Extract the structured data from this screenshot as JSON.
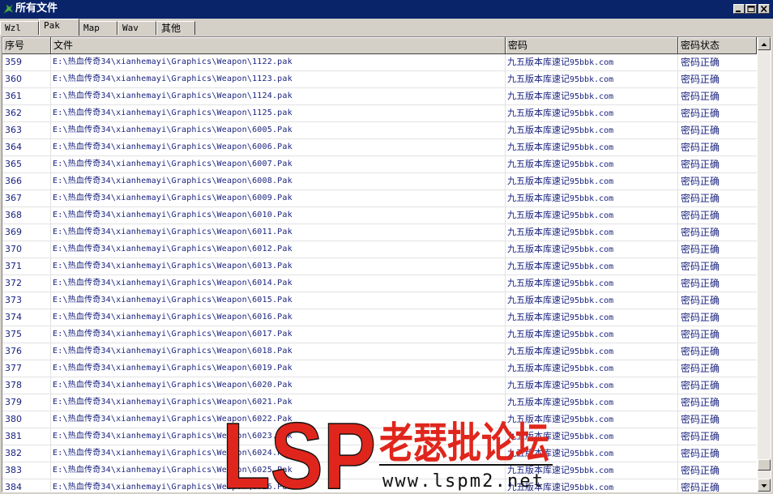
{
  "window": {
    "title": "所有文件"
  },
  "tabs": [
    {
      "label": "Wzl"
    },
    {
      "label": "Pak",
      "active": true
    },
    {
      "label": "Map"
    },
    {
      "label": "Wav"
    },
    {
      "label": "其他"
    }
  ],
  "table": {
    "columns": [
      "序号",
      "文件",
      "密码",
      "密码状态"
    ],
    "rows": [
      {
        "no": "359",
        "file": "E:\\热血传奇34\\xianhemayi\\Graphics\\Weapon\\1122.pak",
        "pwd_cn": "九五版本库速记",
        "pwd_en": "95bbk.com",
        "status": "密码正确"
      },
      {
        "no": "360",
        "file": "E:\\热血传奇34\\xianhemayi\\Graphics\\Weapon\\1123.pak",
        "pwd_cn": "九五版本库速记",
        "pwd_en": "95bbk.com",
        "status": "密码正确"
      },
      {
        "no": "361",
        "file": "E:\\热血传奇34\\xianhemayi\\Graphics\\Weapon\\1124.pak",
        "pwd_cn": "九五版本库速记",
        "pwd_en": "95bbk.com",
        "status": "密码正确"
      },
      {
        "no": "362",
        "file": "E:\\热血传奇34\\xianhemayi\\Graphics\\Weapon\\1125.pak",
        "pwd_cn": "九五版本库速记",
        "pwd_en": "95bbk.com",
        "status": "密码正确"
      },
      {
        "no": "363",
        "file": "E:\\热血传奇34\\xianhemayi\\Graphics\\Weapon\\6005.Pak",
        "pwd_cn": "九五版本库速记",
        "pwd_en": "95bbk.com",
        "status": "密码正确"
      },
      {
        "no": "364",
        "file": "E:\\热血传奇34\\xianhemayi\\Graphics\\Weapon\\6006.Pak",
        "pwd_cn": "九五版本库速记",
        "pwd_en": "95bbk.com",
        "status": "密码正确"
      },
      {
        "no": "365",
        "file": "E:\\热血传奇34\\xianhemayi\\Graphics\\Weapon\\6007.Pak",
        "pwd_cn": "九五版本库速记",
        "pwd_en": "95bbk.com",
        "status": "密码正确"
      },
      {
        "no": "366",
        "file": "E:\\热血传奇34\\xianhemayi\\Graphics\\Weapon\\6008.Pak",
        "pwd_cn": "九五版本库速记",
        "pwd_en": "95bbk.com",
        "status": "密码正确"
      },
      {
        "no": "367",
        "file": "E:\\热血传奇34\\xianhemayi\\Graphics\\Weapon\\6009.Pak",
        "pwd_cn": "九五版本库速记",
        "pwd_en": "95bbk.com",
        "status": "密码正确"
      },
      {
        "no": "368",
        "file": "E:\\热血传奇34\\xianhemayi\\Graphics\\Weapon\\6010.Pak",
        "pwd_cn": "九五版本库速记",
        "pwd_en": "95bbk.com",
        "status": "密码正确"
      },
      {
        "no": "369",
        "file": "E:\\热血传奇34\\xianhemayi\\Graphics\\Weapon\\6011.Pak",
        "pwd_cn": "九五版本库速记",
        "pwd_en": "95bbk.com",
        "status": "密码正确"
      },
      {
        "no": "370",
        "file": "E:\\热血传奇34\\xianhemayi\\Graphics\\Weapon\\6012.Pak",
        "pwd_cn": "九五版本库速记",
        "pwd_en": "95bbk.com",
        "status": "密码正确"
      },
      {
        "no": "371",
        "file": "E:\\热血传奇34\\xianhemayi\\Graphics\\Weapon\\6013.Pak",
        "pwd_cn": "九五版本库速记",
        "pwd_en": "95bbk.com",
        "status": "密码正确"
      },
      {
        "no": "372",
        "file": "E:\\热血传奇34\\xianhemayi\\Graphics\\Weapon\\6014.Pak",
        "pwd_cn": "九五版本库速记",
        "pwd_en": "95bbk.com",
        "status": "密码正确"
      },
      {
        "no": "373",
        "file": "E:\\热血传奇34\\xianhemayi\\Graphics\\Weapon\\6015.Pak",
        "pwd_cn": "九五版本库速记",
        "pwd_en": "95bbk.com",
        "status": "密码正确"
      },
      {
        "no": "374",
        "file": "E:\\热血传奇34\\xianhemayi\\Graphics\\Weapon\\6016.Pak",
        "pwd_cn": "九五版本库速记",
        "pwd_en": "95bbk.com",
        "status": "密码正确"
      },
      {
        "no": "375",
        "file": "E:\\热血传奇34\\xianhemayi\\Graphics\\Weapon\\6017.Pak",
        "pwd_cn": "九五版本库速记",
        "pwd_en": "95bbk.com",
        "status": "密码正确"
      },
      {
        "no": "376",
        "file": "E:\\热血传奇34\\xianhemayi\\Graphics\\Weapon\\6018.Pak",
        "pwd_cn": "九五版本库速记",
        "pwd_en": "95bbk.com",
        "status": "密码正确"
      },
      {
        "no": "377",
        "file": "E:\\热血传奇34\\xianhemayi\\Graphics\\Weapon\\6019.Pak",
        "pwd_cn": "九五版本库速记",
        "pwd_en": "95bbk.com",
        "status": "密码正确"
      },
      {
        "no": "378",
        "file": "E:\\热血传奇34\\xianhemayi\\Graphics\\Weapon\\6020.Pak",
        "pwd_cn": "九五版本库速记",
        "pwd_en": "95bbk.com",
        "status": "密码正确"
      },
      {
        "no": "379",
        "file": "E:\\热血传奇34\\xianhemayi\\Graphics\\Weapon\\6021.Pak",
        "pwd_cn": "九五版本库速记",
        "pwd_en": "95bbk.com",
        "status": "密码正确"
      },
      {
        "no": "380",
        "file": "E:\\热血传奇34\\xianhemayi\\Graphics\\Weapon\\6022.Pak",
        "pwd_cn": "九五版本库速记",
        "pwd_en": "95bbk.com",
        "status": "密码正确"
      },
      {
        "no": "381",
        "file": "E:\\热血传奇34\\xianhemayi\\Graphics\\Weapon\\6023.Pak",
        "pwd_cn": "九五版本库速记",
        "pwd_en": "95bbk.com",
        "status": "密码正确"
      },
      {
        "no": "382",
        "file": "E:\\热血传奇34\\xianhemayi\\Graphics\\Weapon\\6024.Pak",
        "pwd_cn": "九五版本库速记",
        "pwd_en": "95bbk.com",
        "status": "密码正确"
      },
      {
        "no": "383",
        "file": "E:\\热血传奇34\\xianhemayi\\Graphics\\Weapon\\6025.Pak",
        "pwd_cn": "九五版本库速记",
        "pwd_en": "95bbk.com",
        "status": "密码正确"
      },
      {
        "no": "384",
        "file": "E:\\热血传奇34\\xianhemayi\\Graphics\\Weapon\\6026.Pak",
        "pwd_cn": "九五版本库速记",
        "pwd_en": "95bbk.com",
        "status": "密码正确"
      }
    ]
  },
  "watermark": {
    "logo": "LSP",
    "name": "老瑟批论坛",
    "url": "www.lspm2.net"
  },
  "icons": {
    "title": "app-icon",
    "minimize": "minimize-icon",
    "maximize": "maximize-icon",
    "close": "close-icon",
    "scroll_up": "arrow-up-icon",
    "scroll_down": "arrow-down-icon"
  },
  "colors": {
    "titlebar": "#0a246a",
    "text_row": "#1a237e",
    "watermark_red": "#e0261c",
    "watermark_black": "#111111"
  }
}
